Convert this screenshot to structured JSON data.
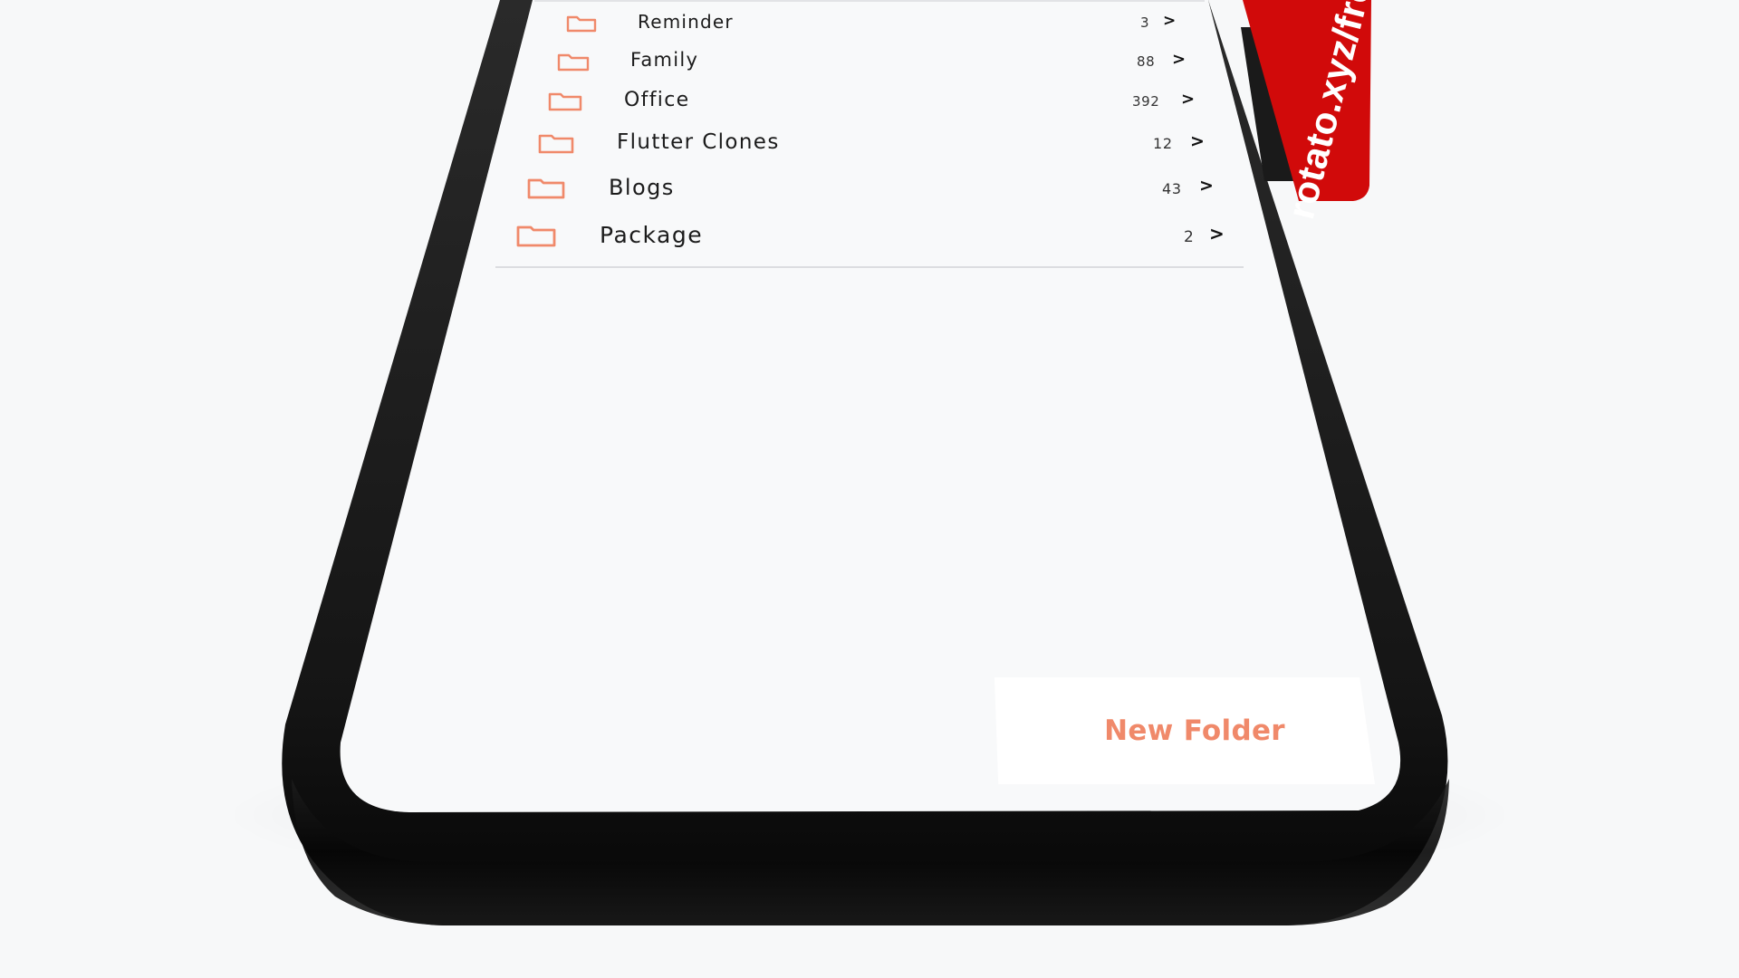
{
  "folders": [
    {
      "name": "Reminder",
      "count": "3"
    },
    {
      "name": "Family",
      "count": "88"
    },
    {
      "name": "Office",
      "count": "392"
    },
    {
      "name": "Flutter Clones",
      "count": "12"
    },
    {
      "name": "Blogs",
      "count": "43"
    },
    {
      "name": "Package",
      "count": "2"
    }
  ],
  "chevron": ">",
  "new_folder_label": "New Folder",
  "ribbon_text": "rotato.xyz/fre",
  "icons": {
    "folder": "folder-icon",
    "chevron": "chevron-right-icon"
  },
  "colors": {
    "accent": "#f0896a",
    "ribbon": "#d40b0b",
    "phone_frame": "#121212",
    "screen_bg": "#f7f8fa"
  }
}
